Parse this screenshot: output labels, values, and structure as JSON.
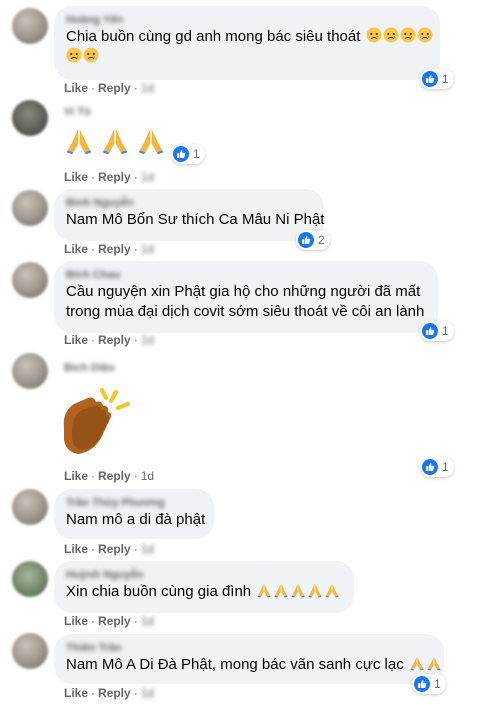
{
  "colors": {
    "bubble": "#f0f2f5",
    "like_blue": "#1877f2",
    "meta_text": "#65676b"
  },
  "comments": [
    {
      "author": "Hoàng Yến",
      "text": "Chia buồn cùng gd anh mong bác siêu thoát",
      "emoji": "sad-face x6",
      "reactions": "1",
      "time": "1d"
    },
    {
      "author": "Vi Tú",
      "text": "",
      "emoji": "folded-hands x3",
      "reactions": "1",
      "time": "1d"
    },
    {
      "author": "Bình Nguyễn",
      "text": "Nam Mô Bổn Sư thích Ca Mâu Ni Phật",
      "reactions": "2",
      "time": "1d"
    },
    {
      "author": "Bích Chau",
      "text_line1": "Cầu nguyện xin Phật gia hộ cho những người đã mất",
      "text_line2": "trong mùa đại dịch covit sớm siêu thoát về côi an lành",
      "reactions": "1",
      "time": "1d"
    },
    {
      "author": "Bích Diệu",
      "text": "",
      "emoji": "clapping-hands sticker",
      "reactions": "1",
      "time": "1d"
    },
    {
      "author": "Trần Thùy Phương",
      "text": "Nam mô a di đà phật",
      "time": "1d"
    },
    {
      "author": "Huỳnh Nguyễn",
      "text": "Xin chia buồn cùng gia đình",
      "emoji": "folded-hands x5",
      "time": "1d"
    },
    {
      "author": "Thiên Trần",
      "text": "Nam Mô A Di Đà Phật, mong bác vãn sanh cực lạc",
      "emoji": "folded-hands x2",
      "reactions": "1",
      "time": "1d"
    }
  ],
  "actions": {
    "like": "Like",
    "reply": "Reply",
    "sep": "·"
  }
}
